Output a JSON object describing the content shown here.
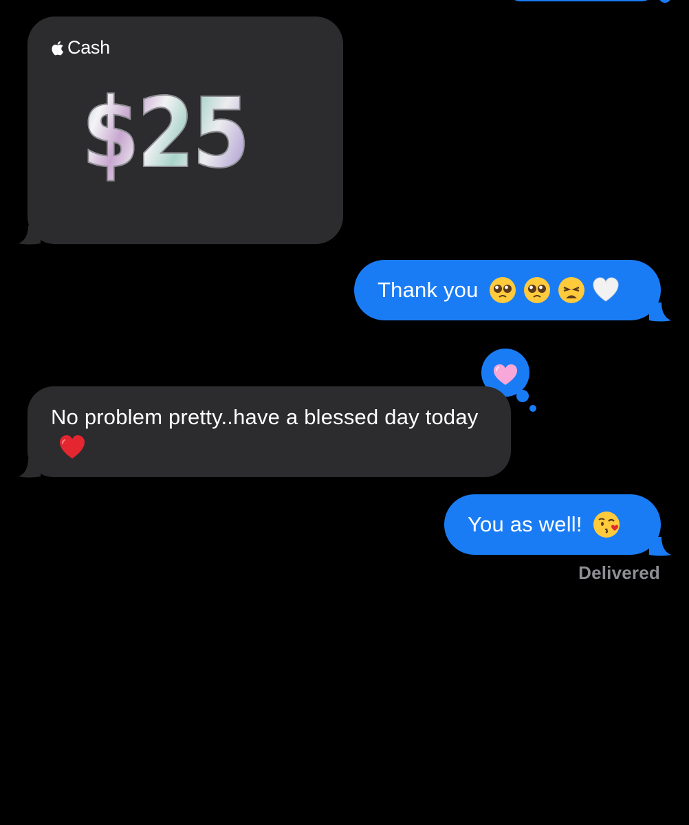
{
  "thread": {
    "apple_cash": {
      "brand": "Cash",
      "amount": "$25"
    },
    "messages": [
      {
        "id": "thanks",
        "direction": "sent",
        "text": "Thank you",
        "emojis": [
          "pleading-face",
          "pleading-face",
          "weary-face",
          "white-heart"
        ]
      },
      {
        "id": "noproblem",
        "direction": "received",
        "text": "No problem pretty..have a blessed day today",
        "emojis": [
          "red-heart"
        ]
      },
      {
        "id": "aswell",
        "direction": "sent",
        "text": "You as well!",
        "emojis": [
          "face-blowing-kiss"
        ]
      }
    ],
    "reaction": {
      "on": "noproblem",
      "emoji": "pink-heart"
    },
    "status": "Delivered"
  },
  "colors": {
    "background": "#000000",
    "sent_bubble": "#1a7cf5",
    "received_bubble": "#2c2c2e",
    "status_text": "#8e8e93"
  }
}
